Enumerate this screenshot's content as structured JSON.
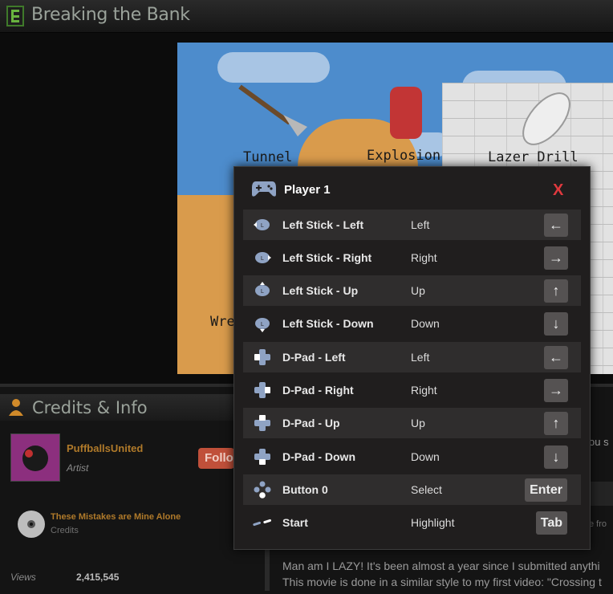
{
  "header": {
    "title": "Breaking the Bank"
  },
  "stage": {
    "labels": {
      "tunnel": "Tunnel",
      "explosion": "Explosion",
      "lazer": "Lazer Drill",
      "partial": "Wre"
    }
  },
  "modal": {
    "title": "Player 1",
    "close_label": "X",
    "rows": [
      {
        "action": "Left Stick - Left",
        "key": "Left",
        "button": "←",
        "icon": "left-stick-left-icon"
      },
      {
        "action": "Left Stick - Right",
        "key": "Right",
        "button": "→",
        "icon": "left-stick-right-icon"
      },
      {
        "action": "Left Stick - Up",
        "key": "Up",
        "button": "↑",
        "icon": "left-stick-up-icon"
      },
      {
        "action": "Left Stick - Down",
        "key": "Down",
        "button": "↓",
        "icon": "left-stick-down-icon"
      },
      {
        "action": "D-Pad - Left",
        "key": "Left",
        "button": "←",
        "icon": "dpad-left-icon"
      },
      {
        "action": "D-Pad - Right",
        "key": "Right",
        "button": "→",
        "icon": "dpad-right-icon"
      },
      {
        "action": "D-Pad - Up",
        "key": "Up",
        "button": "↑",
        "icon": "dpad-up-icon"
      },
      {
        "action": "D-Pad - Down",
        "key": "Down",
        "button": "↓",
        "icon": "dpad-down-icon"
      },
      {
        "action": "Button 0",
        "key": "Select",
        "button": "Enter",
        "icon": "face-buttons-icon"
      },
      {
        "action": "Start",
        "key": "Highlight",
        "button": "Tab",
        "icon": "start-icon"
      }
    ]
  },
  "credits": {
    "title": "Credits & Info",
    "artist_name": "PuffballsUnited",
    "artist_role": "Artist",
    "follow_label": "Follo",
    "song_title": "These Mistakes are Mine Alone",
    "song_role": "Credits",
    "views_label": "Views",
    "views_value": "2,415,545"
  },
  "description": {
    "line1": "Man am I LAZY! It's been almost a year since I submitted anythi",
    "line2": "This movie is done in a similar style to my first video: \"Crossing t",
    "side_fragment_1": "ou s",
    "side_fragment_2": "e fro"
  },
  "colors": {
    "close": "#e0393e",
    "accent_orange": "#b07a2a",
    "follow": "#c0503a"
  }
}
